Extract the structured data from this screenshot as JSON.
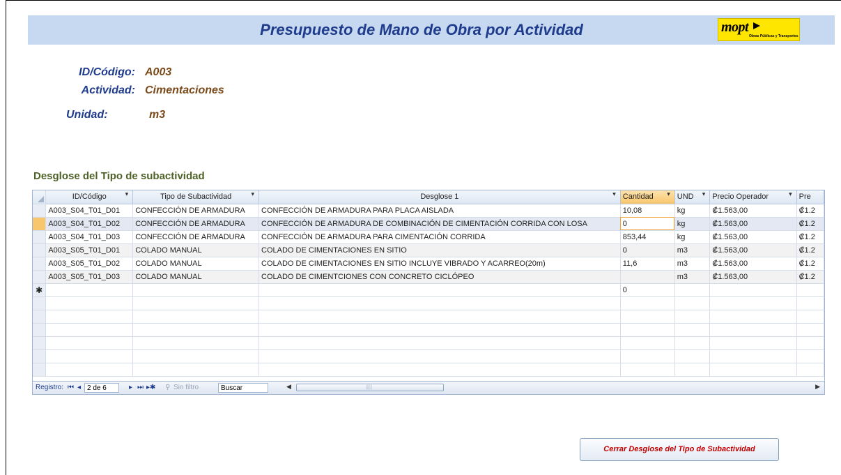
{
  "form": {
    "title": "Presupuesto de Mano de Obra por Actividad",
    "logo_text": "mopt",
    "logo_subtitle": "Obras Públicas y Transportes"
  },
  "info": {
    "id_label": "ID/Código:",
    "id_value": "A003",
    "activity_label": "Actividad:",
    "activity_value": "Cimentaciones",
    "unit_label": "Unidad:",
    "unit_value": "m3"
  },
  "section_title": "Desglose del Tipo de subactividad",
  "grid": {
    "columns": [
      "ID/Código",
      "Tipo de Subactividad",
      "Desglose 1",
      "Cantidad",
      "UND",
      "Precio Operador",
      "Pre"
    ],
    "rows": [
      [
        "A003_S04_T01_D01",
        "CONFECCIÓN DE ARMADURA",
        "CONFECCIÓN DE ARMADURA PARA PLACA AISLADA",
        "10,08",
        "kg",
        "₡1.563,00",
        "₡1.2"
      ],
      [
        "A003_S04_T01_D02",
        "CONFECCIÓN DE ARMADURA",
        "CONFECCIÓN DE ARMADURA DE COMBINACIÓN DE CIMENTACIÓN CORRIDA CON LOSA",
        "0",
        "kg",
        "₡1.563,00",
        "₡1.2"
      ],
      [
        "A003_S04_T01_D03",
        "CONFECCIÓN DE ARMADURA",
        "CONFECCIÓN DE ARMADURA PARA CIMENTACIÓN CORRIDA",
        "853,44",
        "kg",
        "₡1.563,00",
        "₡1.2"
      ],
      [
        "A003_S05_T01_D01",
        "COLADO MANUAL",
        "COLADO DE CIMENTACIONES EN SITIO",
        "0",
        "m3",
        "₡1.563,00",
        "₡1.2"
      ],
      [
        "A003_S05_T01_D02",
        "COLADO MANUAL",
        "COLADO DE CIMENTACIONES EN SITIO INCLUYE VIBRADO Y ACARREO(20m)",
        "11,6",
        "m3",
        "₡1.563,00",
        "₡1.2"
      ],
      [
        "A003_S05_T01_D03",
        "COLADO MANUAL",
        "COLADO DE CIMENTCIONES CON CONCRETO CICLÓPEO",
        "",
        "m3",
        "₡1.563,00",
        "₡1.2"
      ]
    ],
    "new_row_marker": "✱",
    "new_row_qty": "0",
    "current_row_index": 1
  },
  "navigation": {
    "record_label": "Registro:",
    "record_position": "2 de 6",
    "filter_label": "Sin filtro",
    "search_label": "Buscar"
  },
  "close_button_label": "Cerrar Desglose del Tipo de Subactividad"
}
